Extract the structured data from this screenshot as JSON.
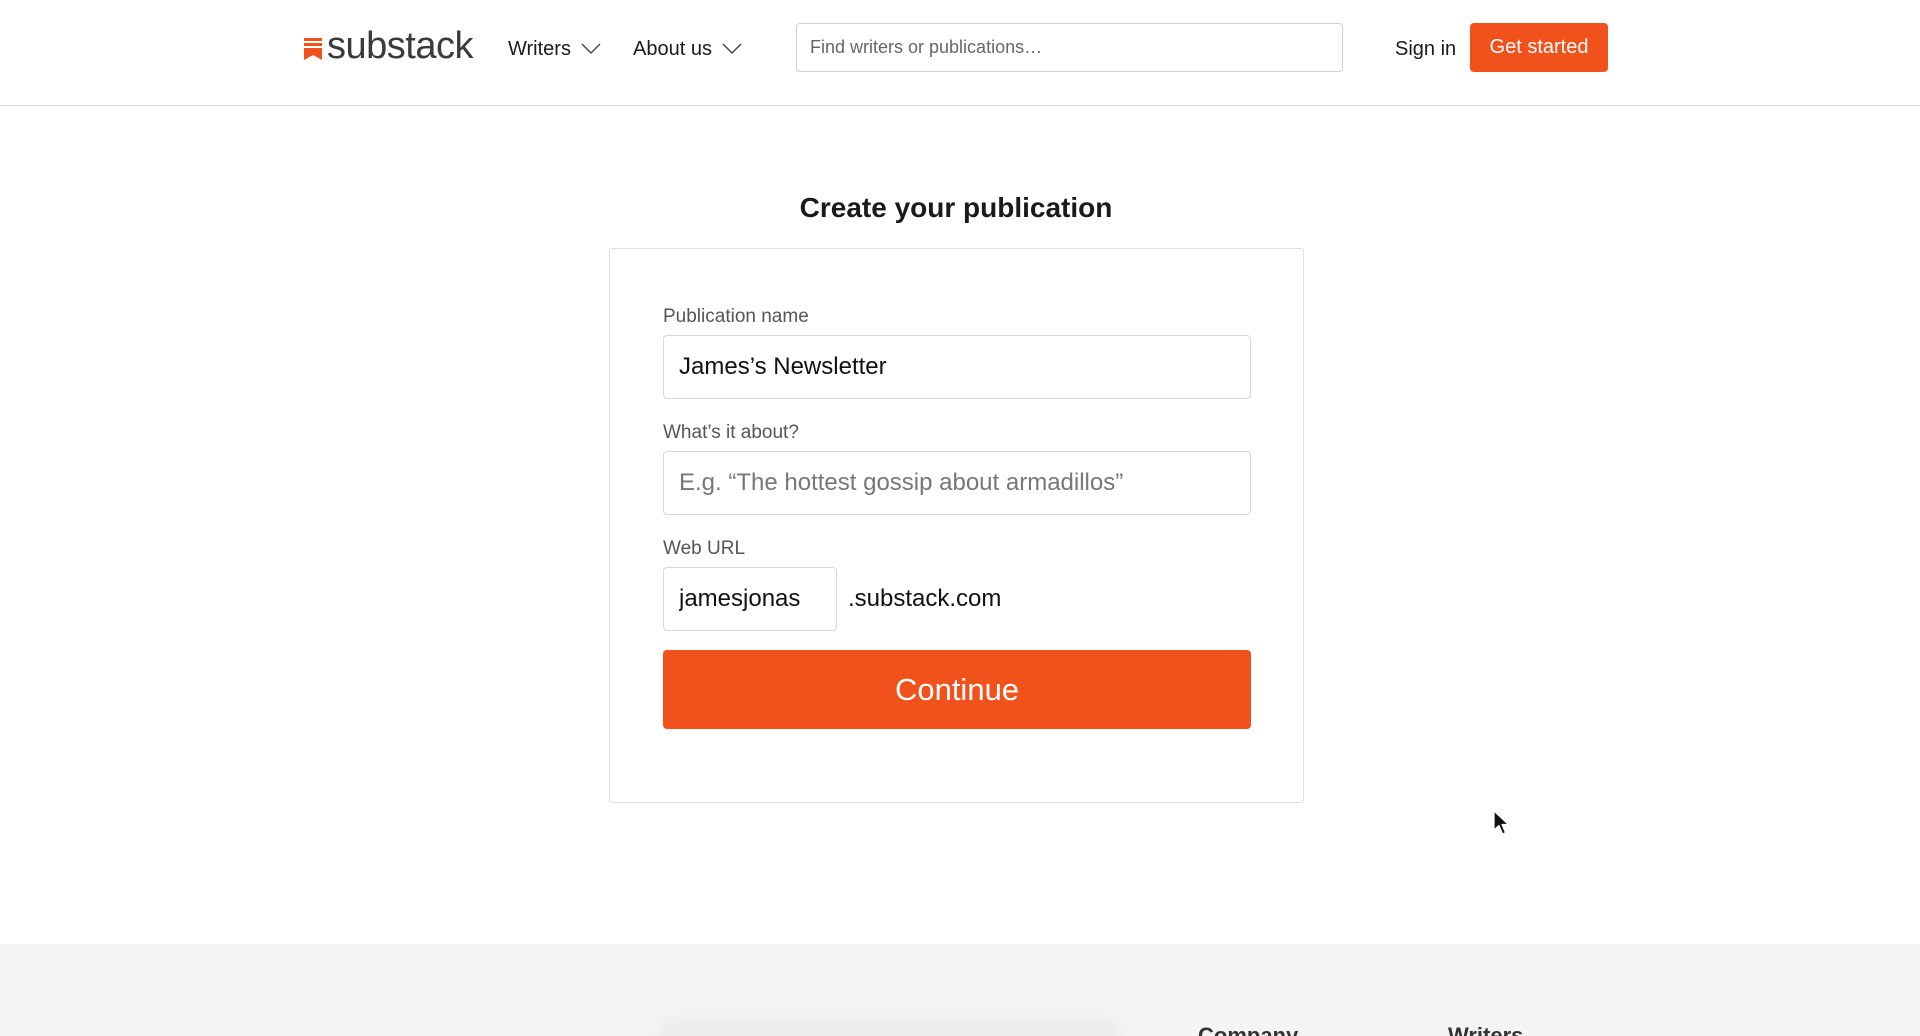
{
  "header": {
    "logo_text": "substack",
    "nav": [
      {
        "label": "Writers"
      },
      {
        "label": "About us"
      }
    ],
    "search_placeholder": "Find writers or publications…",
    "sign_in_label": "Sign in",
    "get_started_label": "Get started"
  },
  "main": {
    "title": "Create your publication",
    "form": {
      "name_label": "Publication name",
      "name_value": "James’s Newsletter",
      "about_label": "What’s it about?",
      "about_placeholder": "E.g. “The hottest gossip about armadillos”",
      "about_value": "",
      "url_label": "Web URL",
      "url_value": "jamesjonas",
      "url_suffix": ".substack.com",
      "continue_label": "Continue"
    }
  },
  "footer": {
    "headings": [
      "Company",
      "Writers"
    ]
  },
  "colors": {
    "accent": "#f1511b",
    "border": "#d8d8d8",
    "footer_bg": "#f4f4f4"
  },
  "icons": [
    "substack-logo-icon",
    "chevron-down-icon",
    "mouse-cursor-icon"
  ]
}
